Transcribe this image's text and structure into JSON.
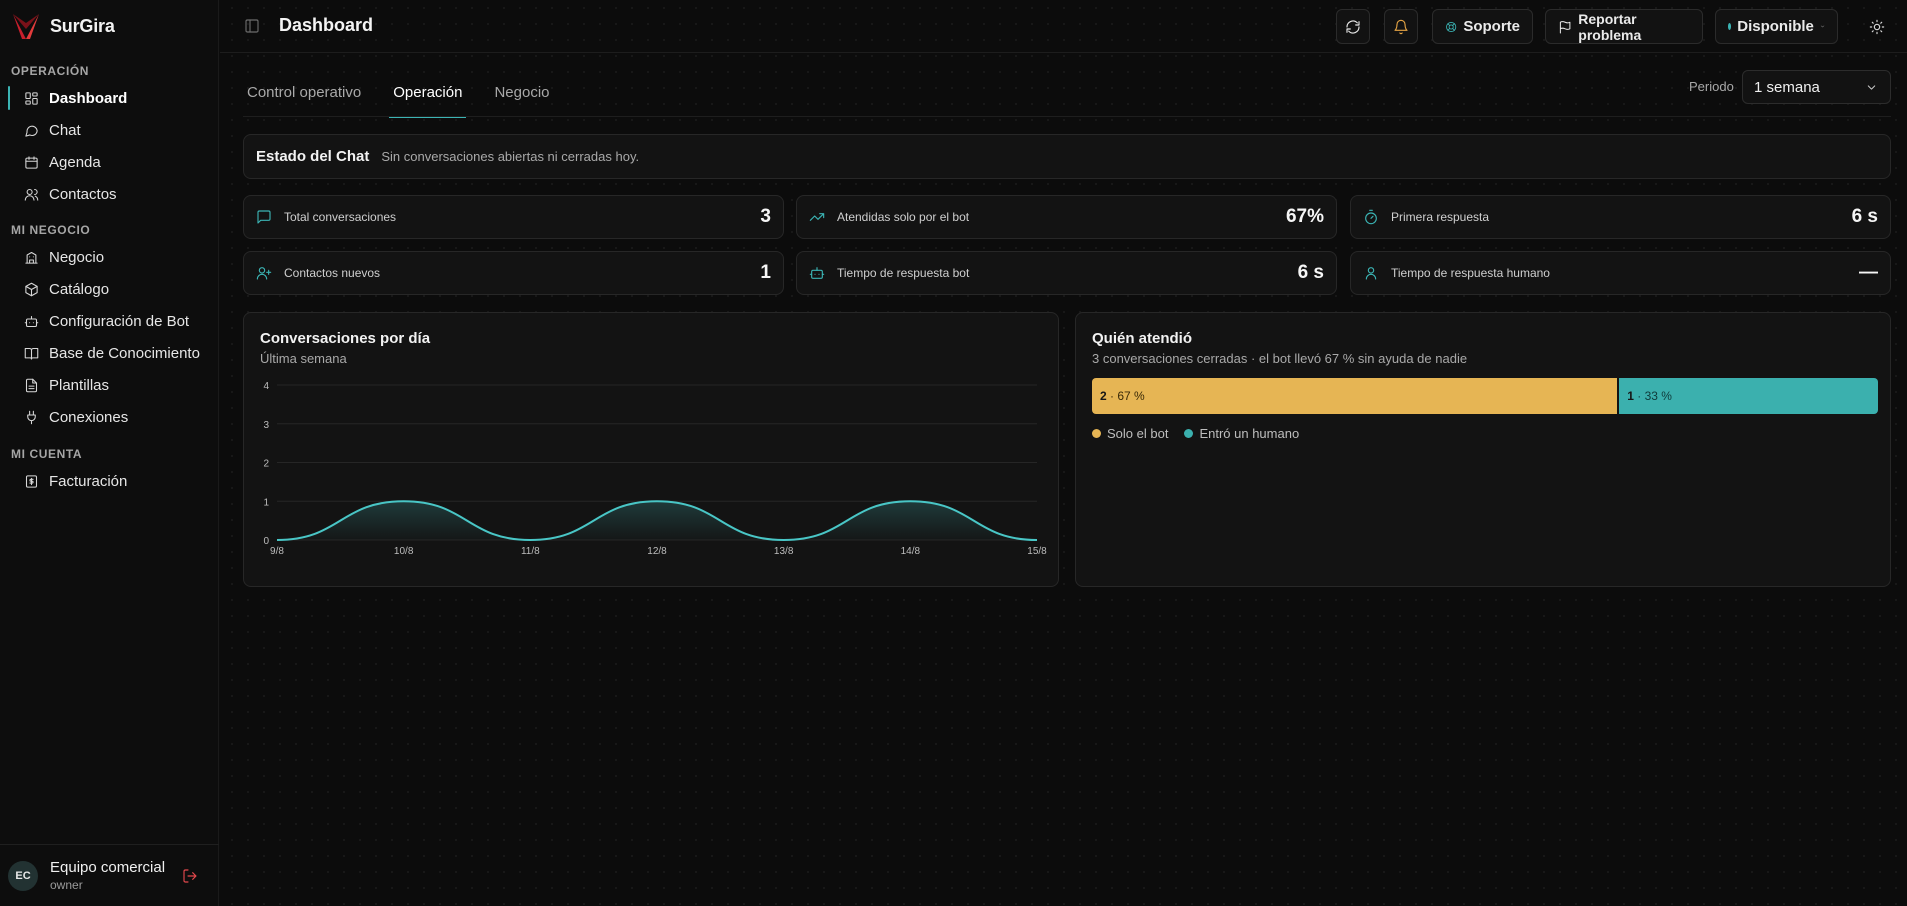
{
  "app": {
    "name": "SurGira"
  },
  "sidebar": {
    "sections": [
      {
        "title": "OPERACIÓN",
        "items": [
          {
            "label": "Dashboard",
            "icon": "dashboard-icon",
            "active": true
          },
          {
            "label": "Chat",
            "icon": "chat-icon"
          },
          {
            "label": "Agenda",
            "icon": "calendar-icon"
          },
          {
            "label": "Contactos",
            "icon": "contacts-icon"
          }
        ]
      },
      {
        "title": "MI NEGOCIO",
        "items": [
          {
            "label": "Negocio",
            "icon": "building-icon"
          },
          {
            "label": "Catálogo",
            "icon": "package-icon"
          },
          {
            "label": "Configuración de Bot",
            "icon": "bot-icon"
          },
          {
            "label": "Base de Conocimiento",
            "icon": "book-icon"
          },
          {
            "label": "Plantillas",
            "icon": "file-icon"
          },
          {
            "label": "Conexiones",
            "icon": "plug-icon"
          }
        ]
      },
      {
        "title": "MI CUENTA",
        "items": [
          {
            "label": "Facturación",
            "icon": "receipt-icon"
          }
        ]
      }
    ],
    "user": {
      "initials": "EC",
      "name": "Equipo comercial",
      "role": "owner"
    }
  },
  "header": {
    "title": "Dashboard",
    "support_label": "Soporte",
    "report_label": "Reportar problema",
    "status_label": "Disponible",
    "status_color": "#3bb4b4"
  },
  "tabs": [
    {
      "label": "Control operativo",
      "active": false
    },
    {
      "label": "Operación",
      "active": true
    },
    {
      "label": "Negocio",
      "active": false
    }
  ],
  "period": {
    "label": "Periodo",
    "value": "1 semana"
  },
  "chat_state": {
    "title": "Estado del Chat",
    "description": "Sin conversaciones abiertas ni cerradas hoy."
  },
  "metrics": [
    {
      "label": "Total conversaciones",
      "value": "3",
      "icon": "message-icon"
    },
    {
      "label": "Atendidas solo por el bot",
      "value": "67%",
      "icon": "trending-up-icon"
    },
    {
      "label": "Primera respuesta",
      "value": "6 s",
      "icon": "timer-icon"
    },
    {
      "label": "Contactos nuevos",
      "value": "1",
      "icon": "user-plus-icon"
    },
    {
      "label": "Tiempo de respuesta bot",
      "value": "6 s",
      "icon": "bot-icon"
    },
    {
      "label": "Tiempo de respuesta humano",
      "value": "—",
      "icon": "user-icon"
    }
  ],
  "conversations_chart": {
    "title": "Conversaciones por día",
    "subtitle": "Última semana"
  },
  "chart_data": {
    "type": "area",
    "title": "Conversaciones por día",
    "subtitle": "Última semana",
    "x": [
      "9/8",
      "10/8",
      "11/8",
      "12/8",
      "13/8",
      "14/8",
      "15/8"
    ],
    "series": [
      {
        "values": [
          0,
          1,
          0,
          1,
          0,
          1,
          0
        ]
      }
    ],
    "ylim": [
      0,
      4
    ],
    "yticks": [
      "0",
      "1",
      "2",
      "3",
      "4"
    ],
    "grid": true,
    "color": "#49c6c6"
  },
  "who": {
    "title": "Quién atendió",
    "subtitle": "3 conversaciones cerradas · el bot llevó 67 % sin ayuda de nadie",
    "segments": [
      {
        "count": "2",
        "percent": "67 %",
        "fraction": 0.67,
        "color": "#e6b554",
        "legend": "Solo el bot"
      },
      {
        "count": "1",
        "percent": "33 %",
        "fraction": 0.33,
        "color": "#3bb0ae",
        "legend": "Entró un humano"
      }
    ]
  }
}
